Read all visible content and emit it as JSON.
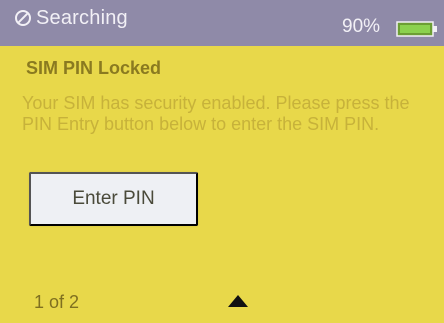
{
  "status_bar": {
    "network_status": "Searching",
    "battery_percent": "90%"
  },
  "alert": {
    "title": "SIM PIN Locked",
    "message": "Your SIM has security enabled. Please press the PIN Entry button below to enter the SIM PIN."
  },
  "actions": {
    "enter_pin_label": "Enter PIN"
  },
  "pagination": {
    "label": "1 of 2"
  },
  "icons": {
    "status": "no-signal-icon",
    "battery": "battery-icon",
    "navigation": "up-arrow-icon"
  },
  "colors": {
    "background": "#e8d84a",
    "status_bar": "#8f8aa8",
    "battery_fill": "#78c840"
  }
}
